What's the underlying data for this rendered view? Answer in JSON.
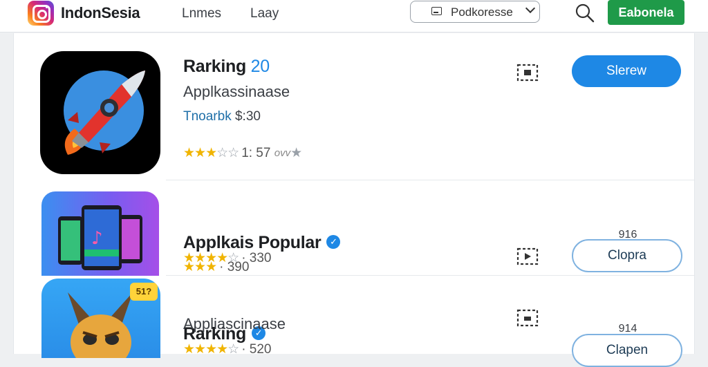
{
  "header": {
    "brand": "IndonSesia",
    "nav": [
      "Lnmes",
      "Laay"
    ],
    "dropdown_label": "Podkoresse",
    "action_button": "Eabonela"
  },
  "apps": [
    {
      "title": "Rarking",
      "title_number": "20",
      "subtitle": "Applkassinaase",
      "price_prefix": "Tnoarbk",
      "price": "$:30",
      "rating_text": "1: 57",
      "rating_suffix": "ovv",
      "stars_filled": 3,
      "stars_total": 5,
      "button_label": "Slerew",
      "button_style": "primary",
      "icon": "rocket-app-icon"
    },
    {
      "title": "Applkais Popular",
      "verified": true,
      "rating_a_text": "390",
      "rating_a_prefix": "·",
      "rating_b_text": "330",
      "rating_b_prefix": "·",
      "stars_a_filled": 3,
      "stars_b_filled": 4,
      "count_label": "916",
      "button_label": "Clopra",
      "button_style": "outline",
      "icon": "music-phones-app-icon"
    },
    {
      "title": "Rarking",
      "verified": true,
      "subtitle": "Appliascinaase",
      "rating_text": "520",
      "rating_prefix": "·",
      "stars_filled": 4,
      "count_label": "914",
      "badge": "51?",
      "button_label": "Clapen",
      "button_style": "outline",
      "icon": "fox-character-app-icon"
    }
  ],
  "colors": {
    "accent_blue": "#1e88e5",
    "action_green": "#1f9a49",
    "star_gold": "#f0b400"
  }
}
